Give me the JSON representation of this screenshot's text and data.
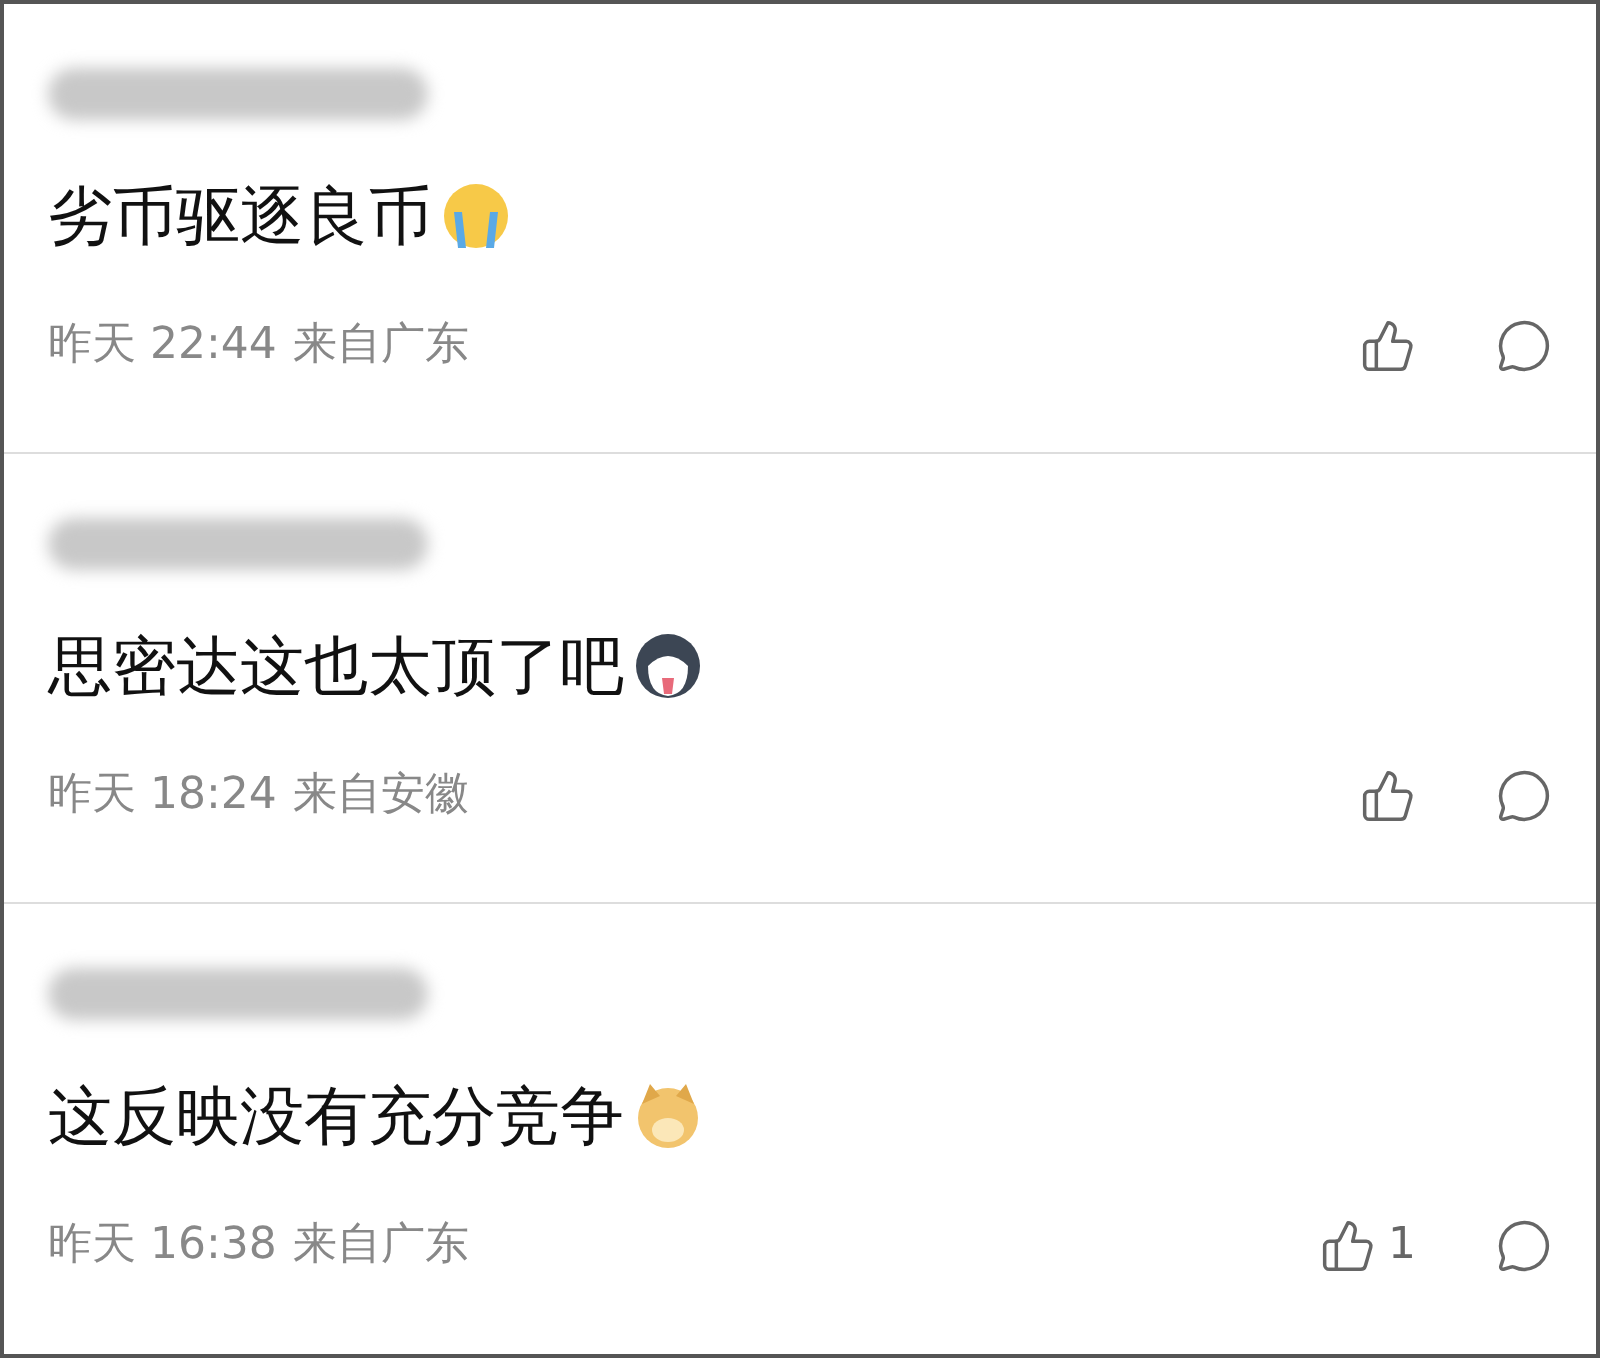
{
  "comments": [
    {
      "text": "劣币驱逐良币",
      "kind": "crying",
      "time": "昨天 22:44",
      "location": "来自广东"
    },
    {
      "text": "思密达这也太顶了吧",
      "kind": "husky",
      "time": "昨天 18:24",
      "location": "来自安徽"
    },
    {
      "text": "这反映没有充分竞争",
      "kind": "dog",
      "time": "昨天 16:38",
      "location": "来自广东",
      "likes": "1"
    }
  ]
}
